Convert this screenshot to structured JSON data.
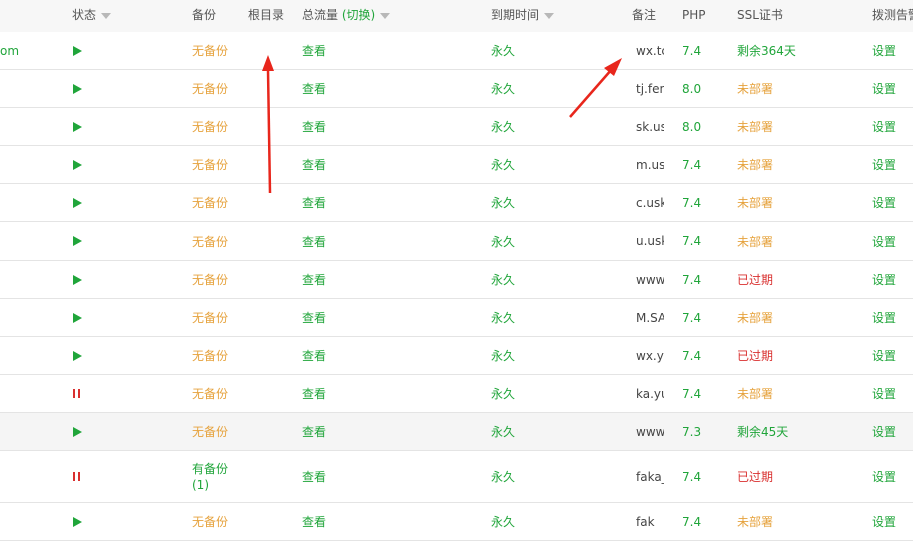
{
  "header": {
    "status": "状态",
    "backup": "备份",
    "root": "根目录",
    "traffic": "总流量",
    "traffic_toggle": "(切换)",
    "expire": "到期时间",
    "remark": "备注",
    "php": "PHP",
    "ssl": "SSL证书",
    "alert": "拨测告警"
  },
  "colors": {
    "green": "#20a53a",
    "orange": "#e6a23c",
    "red": "#d9302f"
  },
  "rows": [
    {
      "name": "om",
      "status_icon": "play-icon",
      "backup": "无备份",
      "traffic": "查看",
      "expire": "永久",
      "remark": "wx.tc",
      "php": "7.4",
      "ssl": "剩余364天",
      "action": "设置"
    },
    {
      "name": "",
      "status_icon": "play-icon",
      "backup": "无备份",
      "traffic": "查看",
      "expire": "永久",
      "remark": "tj.fen",
      "php": "8.0",
      "ssl": "未部署",
      "action": "设置"
    },
    {
      "name": "",
      "status_icon": "play-icon",
      "backup": "无备份",
      "traffic": "查看",
      "expire": "永久",
      "remark": "sk.us",
      "php": "8.0",
      "ssl": "未部署",
      "action": "设置"
    },
    {
      "name": "",
      "status_icon": "play-icon",
      "backup": "无备份",
      "traffic": "查看",
      "expire": "永久",
      "remark": "m.us",
      "php": "7.4",
      "ssl": "未部署",
      "action": "设置"
    },
    {
      "name": "",
      "status_icon": "play-icon",
      "backup": "无备份",
      "traffic": "查看",
      "expire": "永久",
      "remark": "c.usk",
      "php": "7.4",
      "ssl": "未部署",
      "action": "设置"
    },
    {
      "name": "",
      "status_icon": "play-icon",
      "backup": "无备份",
      "traffic": "查看",
      "expire": "永久",
      "remark": "u.usk",
      "php": "7.4",
      "ssl": "未部署",
      "action": "设置"
    },
    {
      "name": "",
      "status_icon": "play-icon",
      "backup": "无备份",
      "traffic": "查看",
      "expire": "永久",
      "remark": "www",
      "php": "7.4",
      "ssl": "已过期",
      "action": "设置"
    },
    {
      "name": "",
      "status_icon": "play-icon",
      "backup": "无备份",
      "traffic": "查看",
      "expire": "永久",
      "remark": "M.SA",
      "php": "7.4",
      "ssl": "未部署",
      "action": "设置"
    },
    {
      "name": "",
      "status_icon": "play-icon",
      "backup": "无备份",
      "traffic": "查看",
      "expire": "永久",
      "remark": "wx.yu",
      "php": "7.4",
      "ssl": "已过期",
      "action": "设置"
    },
    {
      "name": "",
      "status_icon": "pause-icon",
      "backup": "无备份",
      "traffic": "查看",
      "expire": "永久",
      "remark": "ka.yu",
      "php": "7.4",
      "ssl": "未部署",
      "action": "设置"
    },
    {
      "name": "",
      "status_icon": "play-icon",
      "backup": "无备份",
      "traffic": "查看",
      "expire": "永久",
      "remark": "www",
      "php": "7.3",
      "ssl": "剩余45天",
      "action": "设置"
    },
    {
      "name": "",
      "status_icon": "pause-icon",
      "backup": "有备份",
      "backup_count": "(1)",
      "traffic": "查看",
      "expire": "永久",
      "remark": "faka_",
      "php": "7.4",
      "ssl": "已过期",
      "action": "设置"
    },
    {
      "name": "",
      "status_icon": "play-icon",
      "backup": "无备份",
      "traffic": "查看",
      "expire": "永久",
      "remark": "fak",
      "php": "7.4",
      "ssl": "未部署",
      "action": "设置"
    }
  ]
}
